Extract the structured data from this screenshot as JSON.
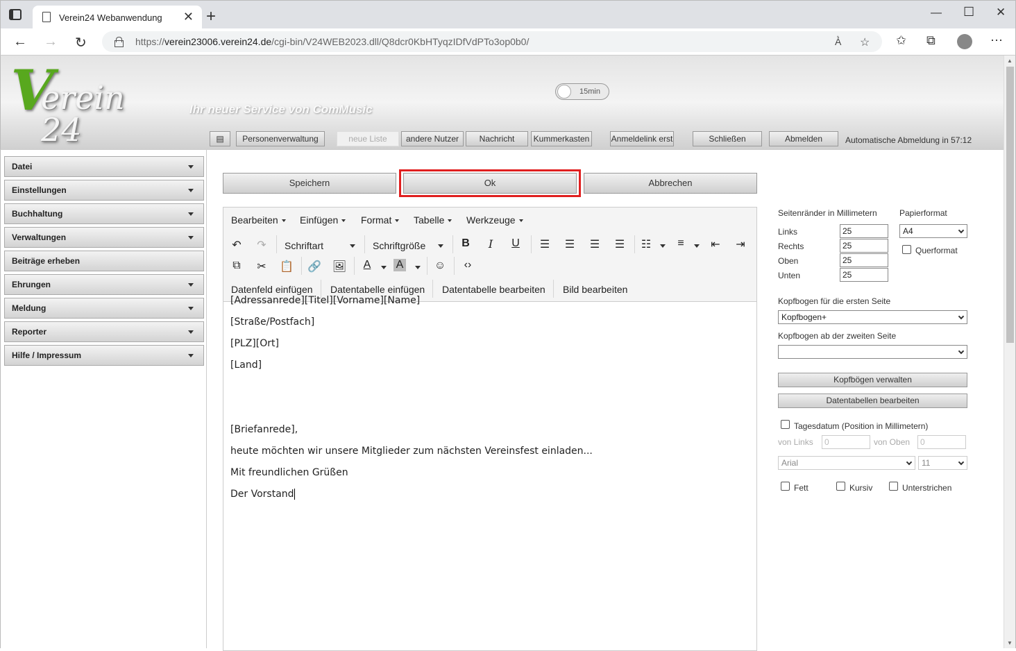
{
  "browser": {
    "tab_title": "Verein24 Webanwendung",
    "url_prefix": "https://",
    "url_host": "verein23006.verein24.de",
    "url_path": "/cgi-bin/V24WEB2023.dll/Q8dcr0KbHTyqzIDfVdPTo3op0b0/"
  },
  "header": {
    "logo_v": "V",
    "logo_rest": "erein 24",
    "tagline": "Ihr neuer Service von ComMusic",
    "timer_label": "15min",
    "menu_icon": "▤",
    "buttons": {
      "personen": "Personenverwaltung",
      "neue_liste": "neue Liste",
      "andere_nutzer": "andere Nutzer",
      "nachricht": "Nachricht",
      "kummerkasten": "Kummerkasten",
      "anmeldelink": "Anmeldelink erst",
      "schliessen": "Schließen",
      "abmelden": "Abmelden"
    },
    "auto_logout": "Automatische Abmeldung in 57:12"
  },
  "sidebar": {
    "items": [
      {
        "label": "Datei"
      },
      {
        "label": "Einstellungen"
      },
      {
        "label": "Buchhaltung"
      },
      {
        "label": "Verwaltungen"
      },
      {
        "label": "Beiträge erheben"
      },
      {
        "label": "Ehrungen"
      },
      {
        "label": "Meldung"
      },
      {
        "label": "Reporter"
      },
      {
        "label": "Hilfe / Impressum"
      }
    ]
  },
  "actions": {
    "save": "Speichern",
    "ok": "Ok",
    "cancel": "Abbrechen"
  },
  "editor": {
    "menus": [
      "Bearbeiten",
      "Einfügen",
      "Format",
      "Tabelle",
      "Werkzeuge"
    ],
    "font_family": "Schriftart",
    "font_size": "Schriftgröße",
    "custom_actions": [
      "Datenfeld einfügen",
      "Datentabelle einfügen",
      "Datentabelle bearbeiten",
      "Bild bearbeiten"
    ],
    "lines": [
      "[Adressanrede][Titel][Vorname][Name]",
      "[Straße/Postfach]",
      "[PLZ][Ort]",
      "[Land]",
      "[Briefanrede],",
      "heute möchten wir unsere Mitglieder zum nächsten Vereinsfest einladen...",
      "Mit freundlichen Grüßen",
      "Der Vorstand"
    ]
  },
  "settings": {
    "margins_label": "Seitenränder in Millimetern",
    "paper_label": "Papierformat",
    "paper_value": "A4",
    "landscape_label": "Querformat",
    "left_label": "Links",
    "left_value": "25",
    "right_label": "Rechts",
    "right_value": "25",
    "top_label": "Oben",
    "top_value": "25",
    "bottom_label": "Unten",
    "bottom_value": "25",
    "letterhead_first_label": "Kopfbogen für die ersten Seite",
    "letterhead_first_value": "Kopfbogen+",
    "letterhead_second_label": "Kopfbogen ab der zweiten Seite",
    "letterhead_second_value": "",
    "manage_letterheads": "Kopfbögen verwalten",
    "edit_datatables": "Datentabellen bearbeiten",
    "date_label": "Tagesdatum (Position in Millimetern)",
    "from_left_label": "von Links",
    "from_left_value": "0",
    "from_top_label": "von Oben",
    "from_top_value": "0",
    "font_value": "Arial",
    "size_value": "11",
    "bold_label": "Fett",
    "italic_label": "Kursiv",
    "underline_label": "Unterstrichen"
  }
}
